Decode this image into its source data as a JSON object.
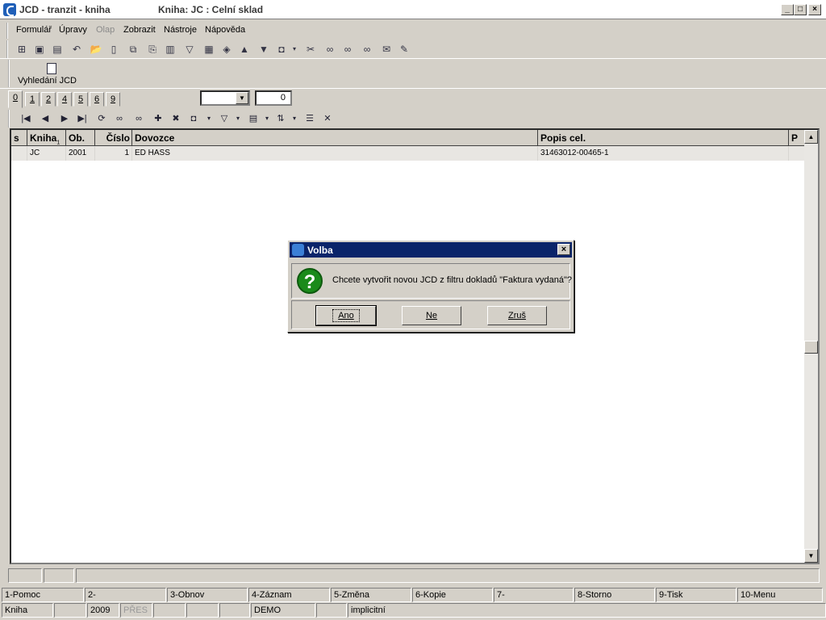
{
  "window": {
    "app_title": "JCD - tranzit - kniha",
    "book_title": "Kniha: JC : Celní sklad"
  },
  "menu": [
    {
      "label": "Formulář",
      "disabled": false
    },
    {
      "label": "Úpravy",
      "disabled": false
    },
    {
      "label": "Olap",
      "disabled": true
    },
    {
      "label": "Zobrazit",
      "disabled": false
    },
    {
      "label": "Nástroje",
      "disabled": false
    },
    {
      "label": "Nápověda",
      "disabled": false
    }
  ],
  "search_button": {
    "label": "Vyhledání JCD"
  },
  "tabs": [
    "0",
    "1",
    "2",
    "4",
    "5",
    "6",
    "9"
  ],
  "filter": {
    "combo_value": "",
    "counter": "0"
  },
  "grid": {
    "columns": [
      "s",
      "Kniha",
      "Ob.",
      "Číslo",
      "Dovozce",
      "Popis cel.",
      "P"
    ],
    "kniha_sub": "1",
    "rows": [
      {
        "s": "",
        "kniha": "JC",
        "ob": "2001",
        "cislo": "1",
        "dovozce": "ED HASS",
        "popis": "31463012-00465-1",
        "p": ""
      }
    ]
  },
  "fkeys": [
    "1-Pomoc",
    "2-",
    "3-Obnov",
    "4-Záznam",
    "5-Změna",
    "6-Kopie",
    "7-",
    "8-Storno",
    "9-Tisk",
    "10-Menu"
  ],
  "status": {
    "book": "Kniha",
    "year": "2009",
    "mode": "PŘES",
    "db": "DEMO",
    "profile": "implicitní"
  },
  "dialog": {
    "title": "Volba",
    "message": "Chcete vytvořit novou JCD z filtru dokladů \"Faktura vydaná\"?",
    "buttons": {
      "yes": "Ano",
      "no": "Ne",
      "cancel": "Zruš"
    }
  }
}
